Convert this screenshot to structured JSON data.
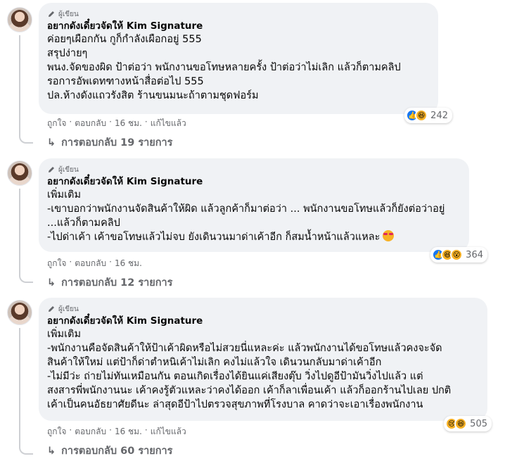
{
  "comments": [
    {
      "author_tag": "ผู้เขียน",
      "author_name": "อยากดังเดี๋ยวจัดให้ Kim Signature",
      "lines": [
        "ค่อยๆเผือกกัน กูก็กำลังเผือกอยู่ 555",
        "สรุปง่ายๆ",
        "พนง.จัดของผิด ป้าต่อว่า พนักงานขอโทษหลายครั้ง ป้าต่อว่าไม่เลิก แล้วก็ตามคลิป",
        "รอการอัพเดทฑางหน้าสื่อต่อไป 555",
        "ปล.ห้างดังแถวรังสิต ร้านขนมนะถ้าตามชุดฟอร์ม"
      ],
      "reaction_count": "242",
      "reaction_icons": [
        "like-icon",
        "haha-icon"
      ],
      "actions": {
        "like": "ถูกใจ",
        "reply": "ตอบกลับ",
        "time": "16 ชม.",
        "edited": "แก้ไขแล้ว"
      },
      "replies_label": "การตอบกลับ 19 รายการ"
    },
    {
      "author_tag": "ผู้เขียน",
      "author_name": "อยากดังเดี๋ยวจัดให้ Kim Signature",
      "lines": [
        "เพิ่มเติม",
        "-เขาบอกว่าพนักงานจัดสินค้าให้ผิด แล้วลูกค้าก็มาต่อว่า ... พนักงานขอโทษแล้วก็ยังต่อว่าอยู่",
        "...แล้วก็ตามคลิป",
        "-ไปด่าเค้า เค้าขอโทษแล้วไม่จบ ยังเดินวนมาด่าเค้าอีก ก็สมน้ำหน้าแล้วแหละ"
      ],
      "reaction_count": "364",
      "reaction_icons": [
        "like-icon",
        "haha-icon",
        "wow-icon"
      ],
      "actions": {
        "like": "ถูกใจ",
        "reply": "ตอบกลับ",
        "time": "16 ชม."
      },
      "replies_label": "การตอบกลับ 12 รายการ"
    },
    {
      "author_tag": "ผู้เขียน",
      "author_name": "อยากดังเดี๋ยวจัดให้ Kim Signature",
      "lines": [
        "เพิ่มเติม",
        "-พนักงานคือจัดสินค้าให้ป้าเค้าผิดหรือไม่สวยนี่แหละค่ะ แล้วพนักงานได้ขอโทษแล้วคงจะจัด",
        "สินค้าให้ใหม่ แต่ป้าก็ด่าตำหนิเค้าไม่เลิก คงไม่แล้วใจ เดินวนกลับมาด่าเค้าอีก",
        "-ไม่มีว่ะ ถ่ายไม่ทันเหมือนกัน ตอนเกิดเรื่องได้ยินแค่เสียงตุ๊บ วิ่งไปดูอีป้ามันวิ่งไปแล้ว แต่",
        "สงสารพี่พนักงานนะ เค้าคงรู้ตัวแหละว่าคงได้ออก เค้าก็ลาเพื่อนเค้า แล้วก็ออกร้านไปเลย ปกติ",
        "เค้าเป็นคนอัธยาศัยดีนะ ล่าสุดอีป้าไปตรวจสุขภาพที่โรงบาล คาดว่าจะเอาเรื่องพนักงาน"
      ],
      "reaction_count": "505",
      "reaction_icons": [
        "sad-icon",
        "haha-icon"
      ],
      "actions": {
        "like": "ถูกใจ",
        "reply": "ตอบกลับ",
        "time": "16 ชม.",
        "edited": "แก้ไขแล้ว"
      },
      "replies_label": "การตอบกลับ 60 รายการ"
    }
  ]
}
